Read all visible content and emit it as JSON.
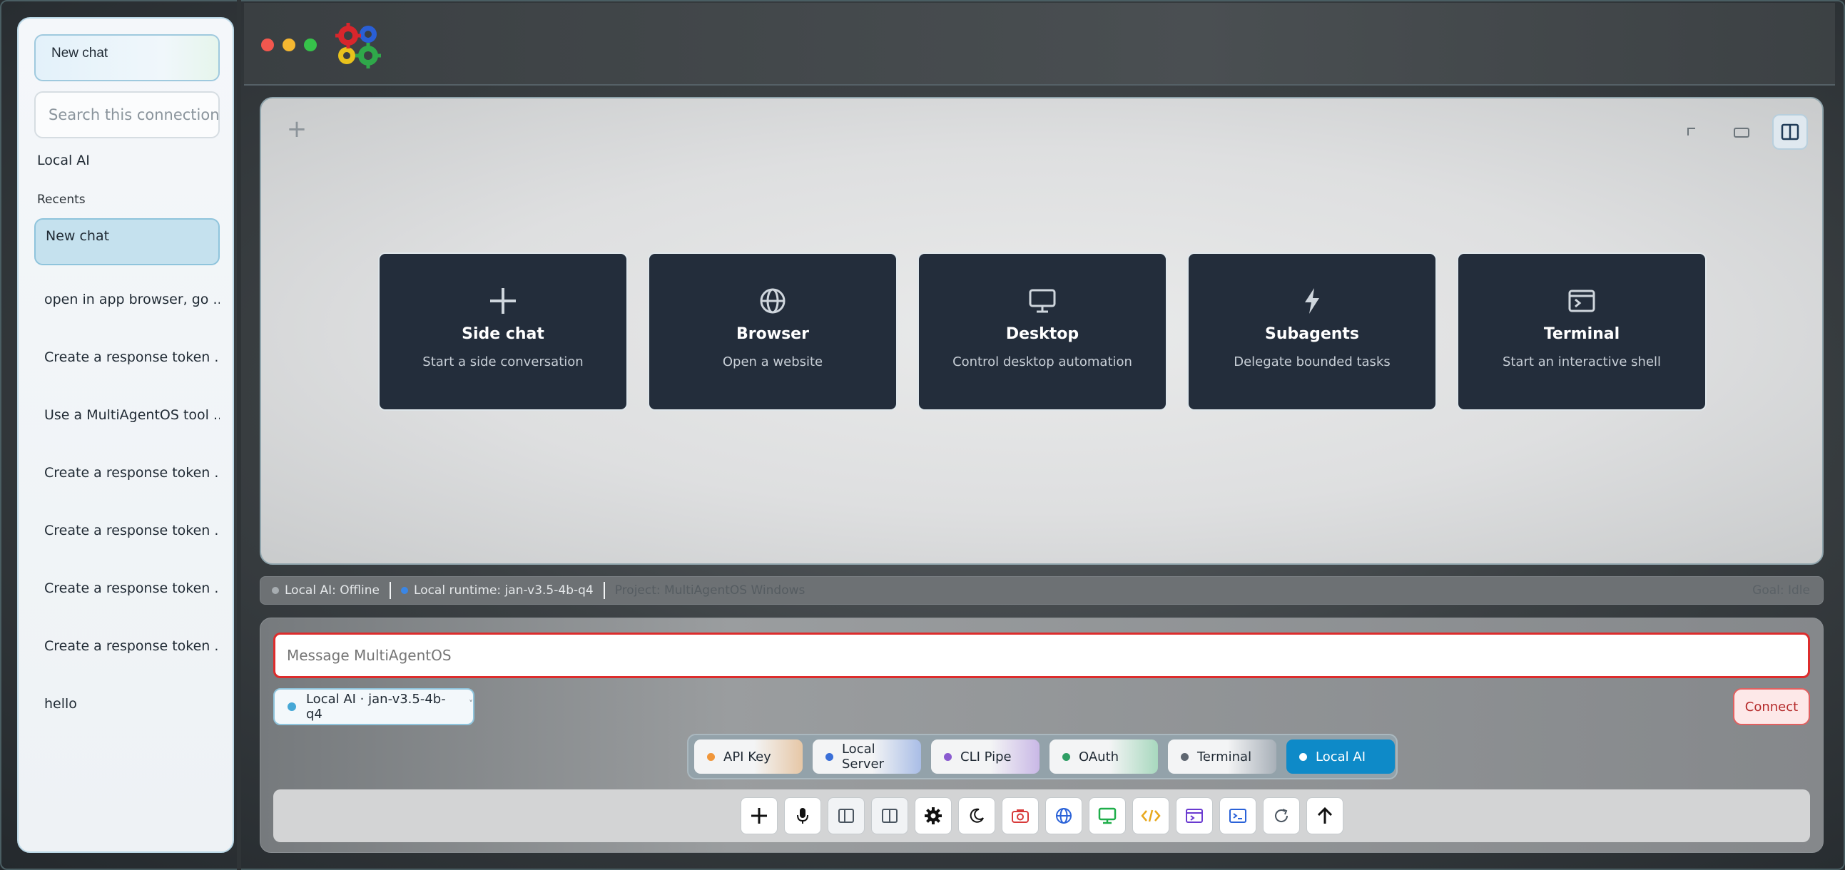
{
  "sidebar": {
    "new_chat_label": "New chat",
    "search_placeholder": "Search this connection's chats",
    "provider": "Local AI",
    "recents_label": "Recents",
    "recents": [
      {
        "label": "New chat",
        "active": true
      },
      {
        "label": "open in app browser, go ..."
      },
      {
        "label": "Create a response token ..."
      },
      {
        "label": "Use a MultiAgentOS tool ..."
      },
      {
        "label": "Create a response token ..."
      },
      {
        "label": "Create a response token ..."
      },
      {
        "label": "Create a response token ..."
      },
      {
        "label": "Create a response token ..."
      },
      {
        "label": "hello"
      }
    ]
  },
  "window": {
    "traffic_lights": [
      "close",
      "minimize",
      "maximize"
    ],
    "logo_icon": "gears-icon"
  },
  "canvas": {
    "add_icon": "+",
    "cards": [
      {
        "title": "Side chat",
        "subtitle": "Start a side conversation",
        "icon": "plus-icon"
      },
      {
        "title": "Browser",
        "subtitle": "Open a website",
        "icon": "globe-icon"
      },
      {
        "title": "Desktop",
        "subtitle": "Control desktop automation",
        "icon": "monitor-icon"
      },
      {
        "title": "Subagents",
        "subtitle": "Delegate bounded tasks",
        "icon": "lightning-icon"
      },
      {
        "title": "Terminal",
        "subtitle": "Start an interactive shell",
        "icon": "terminal-icon"
      }
    ]
  },
  "status": {
    "local_ai": "Local AI: Offline",
    "runtime": "Local runtime: jan-v3.5-4b-q4",
    "project": "Project: MultiAgentOS Windows",
    "goal": "Goal: Idle"
  },
  "composer": {
    "placeholder": "Message MultiAgentOS",
    "model_label": "Local AI · jan-v3.5-4b-q4",
    "connect_label": "Connect",
    "providers": [
      {
        "label": "API Key",
        "color": "#f0963a"
      },
      {
        "label": "Local Server",
        "color": "#3a6fd8"
      },
      {
        "label": "CLI Pipe",
        "color": "#8a5bd0"
      },
      {
        "label": "OAuth",
        "color": "#2e9e64"
      },
      {
        "label": "Terminal",
        "color": "#5e6670"
      },
      {
        "label": "Local AI",
        "color": "#ffffff",
        "active": true
      }
    ],
    "tools": [
      "add-icon",
      "mic-icon",
      "split-left-icon",
      "split-right-icon",
      "settings-icon",
      "moon-icon",
      "camera-icon",
      "globe-icon",
      "monitor-icon",
      "code-icon",
      "terminal-window-icon",
      "console-icon",
      "refresh-icon",
      "send-icon"
    ]
  },
  "colors": {
    "accent": "#0e8ac8",
    "card_bg": "#232d3b",
    "input_border": "#dd2c2c",
    "connect": "#b52b2b"
  }
}
